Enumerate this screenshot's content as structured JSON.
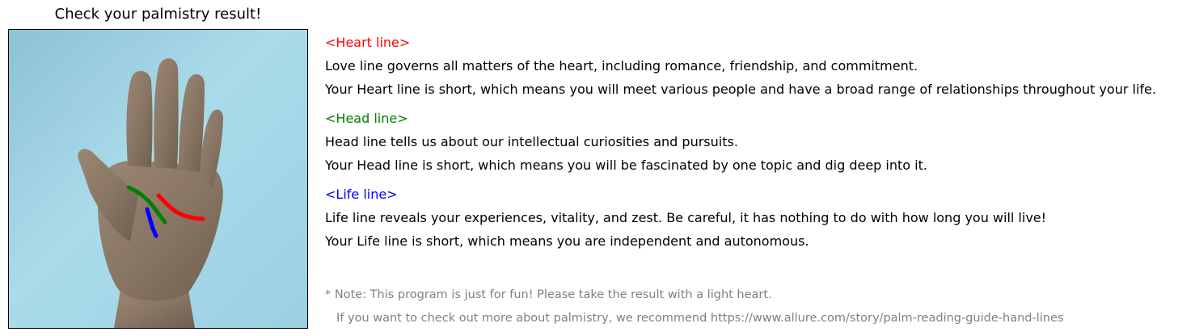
{
  "title": "Check your palmistry result!",
  "colors": {
    "heart_line": "#ff0000",
    "head_line": "#008000",
    "life_line": "#0000ff",
    "note": "#808080"
  },
  "heart": {
    "heading": "<Heart line>",
    "description": "Love line governs all matters of the heart, including romance, friendship, and commitment.",
    "result": "Your Heart line is short, which means you will meet various people and have a broad range of relationships throughout your life."
  },
  "head": {
    "heading": "<Head line>",
    "description": "Head line tells us about our intellectual curiosities and pursuits.",
    "result": "Your Head line is short, which means you will be fascinated by one topic and dig deep into it."
  },
  "life": {
    "heading": "<Life line>",
    "description": "Life line reveals your experiences, vitality, and zest. Be careful, it has nothing to do with how long you will live!",
    "result": "Your Life line is short, which means you are independent and autonomous."
  },
  "note": {
    "line1": "* Note: This program is just for fun! Please take the result with a light heart.",
    "line2": "If you want to check out more about palmistry, we recommend https://www.allure.com/story/palm-reading-guide-hand-lines"
  }
}
